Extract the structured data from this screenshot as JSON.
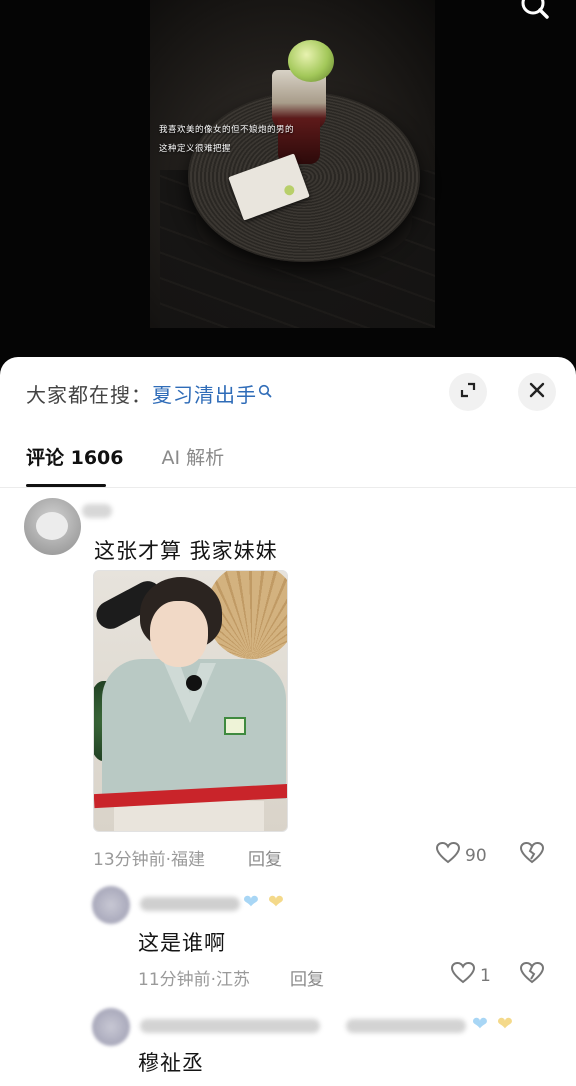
{
  "video": {
    "caption_line1": "我喜欢美的像女的但不娘炮的男的",
    "caption_line2": "这种定义很难把握"
  },
  "panel": {
    "trending_prefix": "大家都在搜：",
    "trending_keyword": "夏习清出手",
    "tabs": [
      {
        "label": "评论 1606",
        "active": true
      },
      {
        "label": "AI 解析",
        "active": false
      }
    ]
  },
  "comments": [
    {
      "text": "这张才算 我家妹妹",
      "time_location": "13分钟前·福建",
      "reply_label": "回复",
      "likes": "90"
    },
    {
      "text": "这是谁啊",
      "time_location": "11分钟前·江苏",
      "reply_label": "回复",
      "likes": "1"
    },
    {
      "text": "穆祉丞"
    }
  ],
  "colors": {
    "accent": "#2f6cb8",
    "panel_bg": "#ffffff",
    "video_bg": "#050505"
  }
}
